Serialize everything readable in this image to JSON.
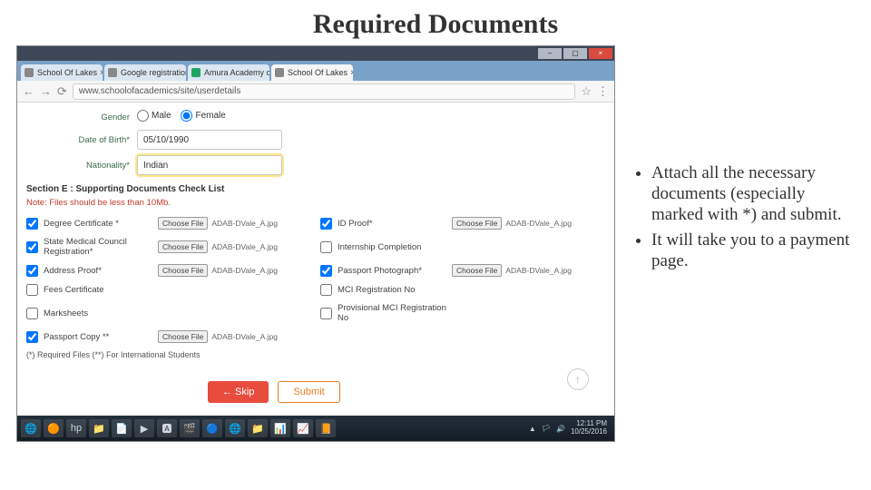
{
  "title": "Required Documents",
  "bullets": [
    "Attach all the necessary documents (especially marked with *) and submit.",
    "It will take you to a payment page."
  ],
  "window": {
    "minimize": "–",
    "maximize": "▢",
    "close": "×"
  },
  "tabs": [
    {
      "label": "School Of Lakes"
    },
    {
      "label": "Google registration"
    },
    {
      "label": "Amura Academy of H"
    },
    {
      "label": "School Of Lakes"
    }
  ],
  "urlbar": {
    "back": "←",
    "forward": "→",
    "reload": "⟳",
    "url": "www.schoolofacademics/site/userdetails",
    "star": "☆",
    "menu": "⋮"
  },
  "form": {
    "gender": {
      "label": "Gender",
      "opt1": "Male",
      "opt2": "Female"
    },
    "dob": {
      "label": "Date of Birth*",
      "value": "05/10/1990"
    },
    "nat": {
      "label": "Nationality*",
      "value": "Indian"
    },
    "section": "Section E : Supporting Documents Check List",
    "note": "Note: Files should be less than 10Mb."
  },
  "docs": [
    {
      "label": "Degree Certificate *",
      "checked": true,
      "file": "ADAB-DVale_A.jpg"
    },
    {
      "label": "ID Proof*",
      "checked": true,
      "file": "ADAB-DVale_A.jpg"
    },
    {
      "label": "State Medical Council Registration*",
      "checked": true,
      "file": "ADAB-DVale_A.jpg"
    },
    {
      "label": "Internship Completion",
      "checked": false,
      "file": null
    },
    {
      "label": "Address Proof*",
      "checked": true,
      "file": "ADAB-DVale_A.jpg"
    },
    {
      "label": "Passport Photograph*",
      "checked": true,
      "file": "ADAB-DVale_A.jpg"
    },
    {
      "label": "Fees Certificate",
      "checked": false,
      "file": null
    },
    {
      "label": "MCI Registration No",
      "checked": false,
      "file": null
    },
    {
      "label": "Marksheets",
      "checked": false,
      "file": null
    },
    {
      "label": "Provisional MCI Registration No",
      "checked": false,
      "file": null
    },
    {
      "label": "Passport Copy **",
      "checked": true,
      "file": "ADAB-DVale_A.jpg"
    },
    {
      "label": "",
      "checked": false,
      "file": null
    }
  ],
  "choose_label": "Choose File",
  "footnote": "(*) Required Files  (**) For International Students",
  "actions": {
    "skip": "← Skip",
    "submit": "Submit"
  },
  "taskbar": {
    "icons": [
      "🌐",
      "🟠",
      "hp",
      "📁",
      "📄",
      "▶",
      "🅰",
      "🎬",
      "🔵",
      "🌐",
      "📁",
      "📊",
      "📈",
      "📙"
    ],
    "clock_time": "12:11 PM",
    "clock_date": "10/25/2016"
  }
}
